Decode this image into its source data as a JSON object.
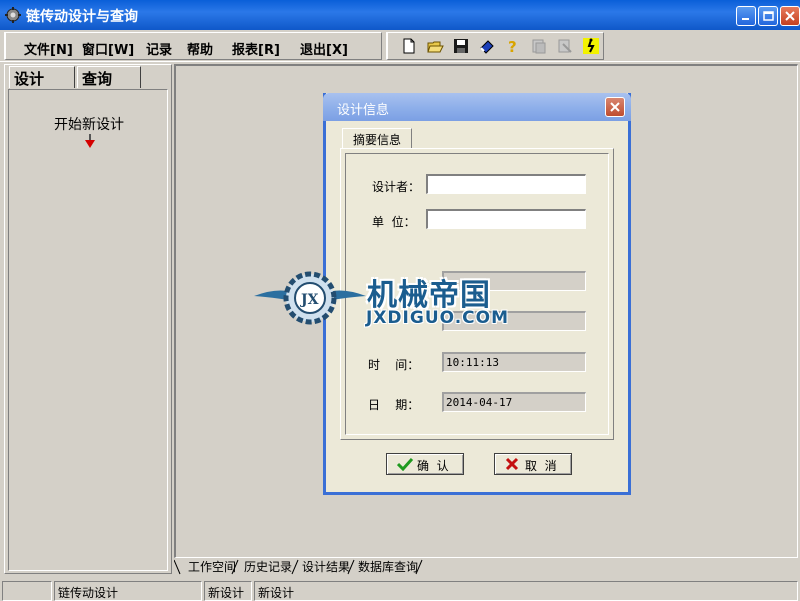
{
  "window": {
    "title": "链传动设计与查询"
  },
  "menu": {
    "items": [
      "文件[N]",
      "窗口[W]",
      "记录",
      "帮助",
      "报表[R]",
      "退出[X]"
    ]
  },
  "toolbar": {
    "icons": [
      "new-file-icon",
      "open-folder-icon",
      "save-icon",
      "eraser-icon",
      "help-icon",
      "disabled-icon",
      "disabled-icon",
      "run-icon"
    ]
  },
  "left_panel": {
    "tabs": [
      "设计",
      "查询"
    ],
    "new_design": "开始新设计"
  },
  "dialog": {
    "title": "设计信息",
    "tab": "摘要信息",
    "fields": {
      "designer_label": "设计者：",
      "designer_value": "",
      "unit_label": "单  位：",
      "unit_value": "",
      "time_label": "时    间：",
      "time_value": "10:11:13",
      "date_label": "日    期：",
      "date_value": "2014-04-17"
    },
    "ok_label": "确  认",
    "cancel_label": "取  消"
  },
  "bottom_tabs": [
    "工作空间",
    "历史记录",
    "设计结果",
    "数据库查询"
  ],
  "status_bar": [
    "",
    "链传动设计",
    "新设计",
    "新设计"
  ],
  "watermark": {
    "text": "机械帝国",
    "sub": "JXDIGUO.COM"
  },
  "colors": {
    "titlebar": "#0a5fd8",
    "dialog_title": "#8fb0ea",
    "face": "#d4d0c8"
  }
}
